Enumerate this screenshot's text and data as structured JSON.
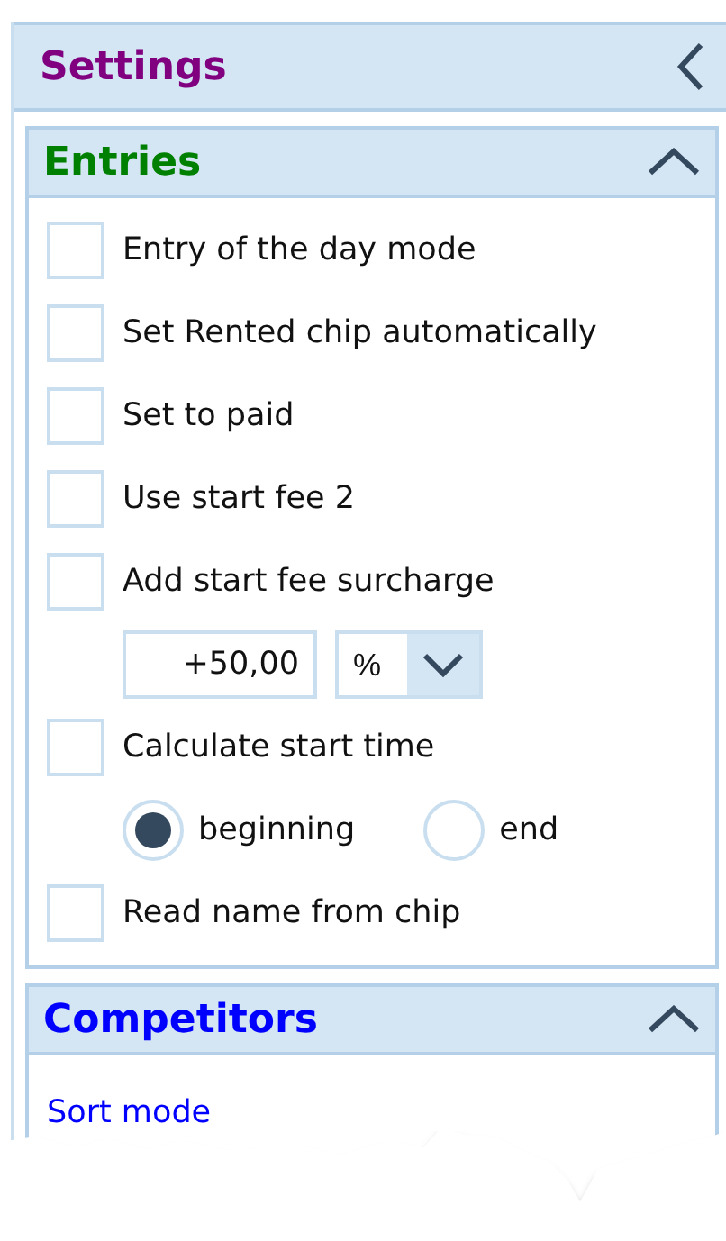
{
  "panel": {
    "title": "Settings"
  },
  "sections": [
    {
      "title": "Entries",
      "color": "#008000",
      "expanded": true,
      "items": [
        {
          "kind": "checkbox",
          "label": "Entry of the day mode",
          "checked": false
        },
        {
          "kind": "checkbox",
          "label": "Set Rented chip automatically",
          "checked": false
        },
        {
          "kind": "checkbox",
          "label": "Set to paid",
          "checked": false
        },
        {
          "kind": "checkbox",
          "label": "Use start fee 2",
          "checked": false
        },
        {
          "kind": "checkbox",
          "label": "Add start fee surcharge",
          "checked": false
        },
        {
          "kind": "amount",
          "value": "+50,00",
          "unit": "%"
        },
        {
          "kind": "checkbox",
          "label": "Calculate start time",
          "checked": false
        },
        {
          "kind": "radios",
          "options": [
            {
              "label": "beginning",
              "selected": true
            },
            {
              "label": "end",
              "selected": false
            }
          ]
        },
        {
          "kind": "checkbox",
          "label": "Read name from chip",
          "checked": false
        }
      ]
    },
    {
      "title": "Competitors",
      "color": "#0000ff",
      "expanded": true,
      "items": [
        {
          "kind": "link",
          "label": "Sort mode"
        }
      ]
    }
  ]
}
